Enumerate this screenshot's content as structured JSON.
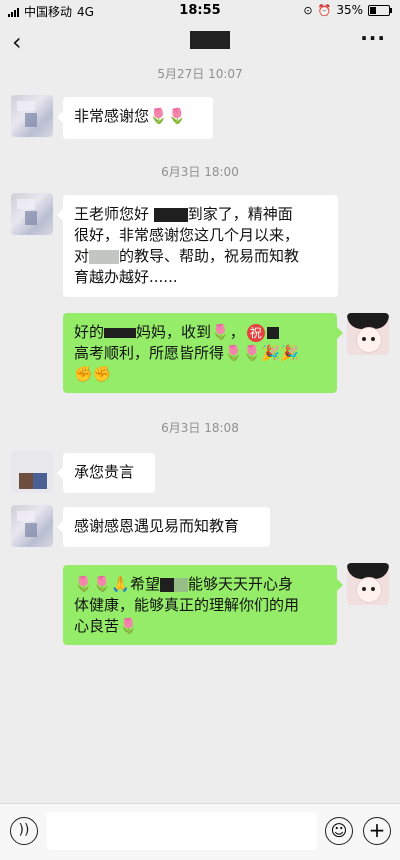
{
  "status_bar": {
    "carrier": "中国移动",
    "network": "4G",
    "time": "18:55",
    "battery": "35%",
    "battery_level": 0.35
  },
  "header": {
    "back_icon": "chevron-left-icon",
    "more_label": "···"
  },
  "timestamps": [
    "5月27日 10:07",
    "6月3日 18:00",
    "6月3日 18:08"
  ],
  "messages": [
    {
      "side": "left",
      "text": "非常感谢您🌷🌷"
    },
    {
      "side": "left",
      "lines": [
        "王老师您好",
        "到家了，精神面",
        "很好，非常感谢您这几个月以来，",
        "对",
        "的教导、帮助，祝易而知教",
        "育越办越好......"
      ]
    },
    {
      "side": "right",
      "lines": [
        "好的",
        "妈妈，收到🌷，",
        "祝",
        "高考顺利，所愿皆所得🌷🌷🎉🎉",
        "✊✊"
      ]
    },
    {
      "side": "left",
      "text": "承您贵言"
    },
    {
      "side": "left",
      "text": "感谢感恩遇见易而知教育"
    },
    {
      "side": "right",
      "lines": [
        "🌷🌷🙏希望",
        "能够天天开心身",
        "体健康，能够真正的理解你们的用",
        "心良苦🌷"
      ]
    }
  ],
  "input_bar": {
    "voice_icon": "voice-icon",
    "emoji_icon": "emoji-icon",
    "plus_icon": "plus-icon"
  }
}
